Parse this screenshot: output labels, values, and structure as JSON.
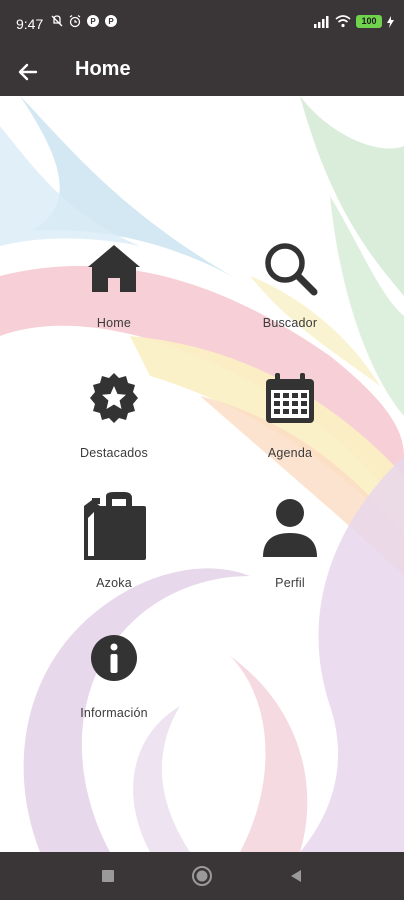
{
  "status_bar": {
    "time": "9:47",
    "battery_level": "100",
    "icons": [
      "mute-icon",
      "alarm-icon",
      "app-notification-icon",
      "app-notification-icon",
      "signal-icon",
      "wifi-icon",
      "battery-icon",
      "charging-icon"
    ]
  },
  "app_bar": {
    "title": "Home",
    "back_icon": "arrow-left-icon"
  },
  "menu": {
    "items": [
      {
        "label": "Home",
        "icon": "house-icon"
      },
      {
        "label": "Buscador",
        "icon": "search-icon"
      },
      {
        "label": "Destacados",
        "icon": "star-badge-icon"
      },
      {
        "label": "Agenda",
        "icon": "calendar-icon"
      },
      {
        "label": "Azoka",
        "icon": "shopping-bag-icon"
      },
      {
        "label": "Perfil",
        "icon": "person-icon"
      },
      {
        "label": "Información",
        "icon": "info-icon"
      }
    ]
  },
  "nav_bar": {
    "buttons": [
      "recents-square-icon",
      "home-circle-icon",
      "back-triangle-icon"
    ]
  },
  "colors": {
    "bars": "#3a3536",
    "icon": "#333333",
    "battery": "#6fd34d"
  }
}
